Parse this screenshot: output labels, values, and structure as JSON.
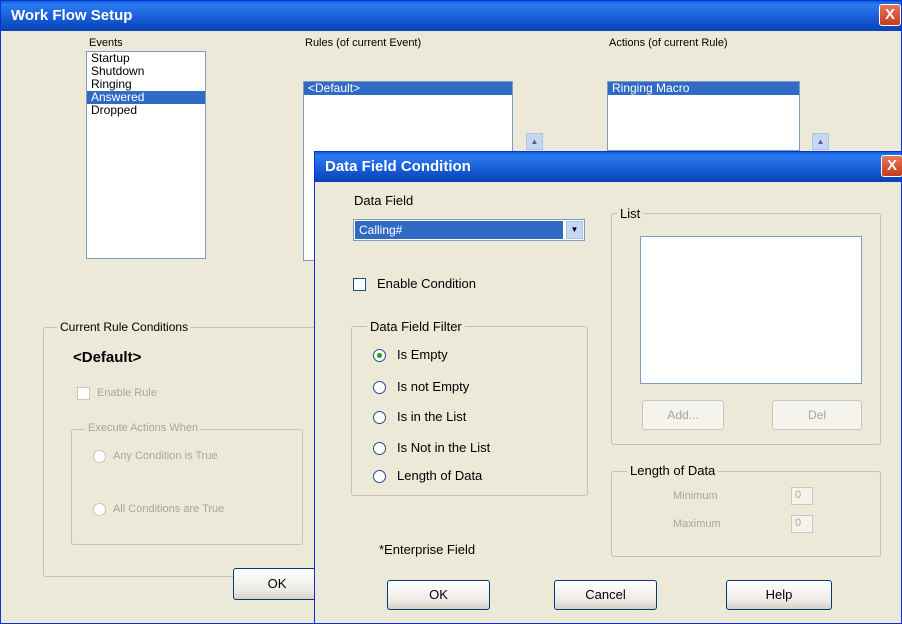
{
  "workflow": {
    "title": "Work Flow Setup",
    "close_glyph": "X",
    "events_label": "Events",
    "events": [
      "Startup",
      "Shutdown",
      "Ringing",
      "Answered",
      "Dropped"
    ],
    "rules_label": "Rules (of current Event)",
    "rules": [
      "<Default>"
    ],
    "actions_label": "Actions (of current Rule)",
    "actions": [
      "Ringing Macro"
    ],
    "conditions_group": "Current Rule Conditions",
    "rule_name": "<Default>",
    "enable_rule": "Enable Rule",
    "execute_group": "Execute Actions When",
    "any_condition": "Any Condition is True",
    "all_conditions": "All Conditions are True",
    "ok": "OK",
    "up_arrow": "▲"
  },
  "dialog": {
    "title": "Data Field Condition",
    "close_glyph": "X",
    "data_field_label": "Data Field",
    "data_field_value": "Calling#",
    "dropdown_glyph": "▼",
    "enable_condition": "Enable Condition",
    "filter_group": "Data Field Filter",
    "filters": [
      "Is Empty",
      "Is not Empty",
      "Is in the List",
      "Is Not in the List",
      "Length of Data"
    ],
    "list_group": "List",
    "add": "Add...",
    "del": "Del",
    "length_group": "Length of Data",
    "minimum_label": "Minimum",
    "minimum_value": "0",
    "maximum_label": "Maximum",
    "maximum_value": "0",
    "enterprise_note": "*Enterprise Field",
    "ok": "OK",
    "cancel": "Cancel",
    "help": "Help"
  }
}
